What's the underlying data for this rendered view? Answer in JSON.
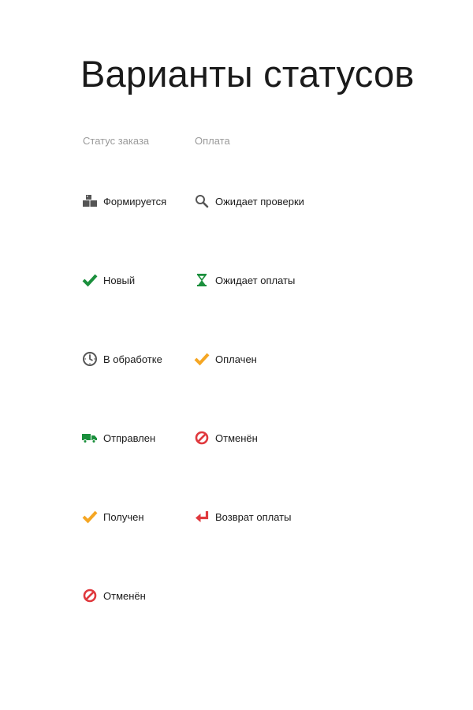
{
  "title": "Варианты статусов",
  "columns": {
    "order_header": "Статус заказа",
    "payment_header": "Оплата"
  },
  "order_statuses": [
    {
      "label": "Формируется",
      "icon": "boxes-icon",
      "color": "#555555"
    },
    {
      "label": "Новый",
      "icon": "checkmark-icon",
      "color": "#1a8f3c"
    },
    {
      "label": "В обработке",
      "icon": "clock-icon",
      "color": "#555555"
    },
    {
      "label": "Отправлен",
      "icon": "truck-icon",
      "color": "#1a8f3c"
    },
    {
      "label": "Получен",
      "icon": "checkmark-icon",
      "color": "#f5a623"
    },
    {
      "label": "Отменён",
      "icon": "cancel-icon",
      "color": "#e0393e"
    }
  ],
  "payment_statuses": [
    {
      "label": "Ожидает проверки",
      "icon": "magnifier-icon",
      "color": "#555555"
    },
    {
      "label": "Ожидает оплаты",
      "icon": "hourglass-icon",
      "color": "#1a8f3c"
    },
    {
      "label": "Оплачен",
      "icon": "checkmark-icon",
      "color": "#f5a623"
    },
    {
      "label": "Отменён",
      "icon": "cancel-icon",
      "color": "#e0393e"
    },
    {
      "label": "Возврат оплаты",
      "icon": "return-arrow-icon",
      "color": "#e0393e"
    }
  ]
}
